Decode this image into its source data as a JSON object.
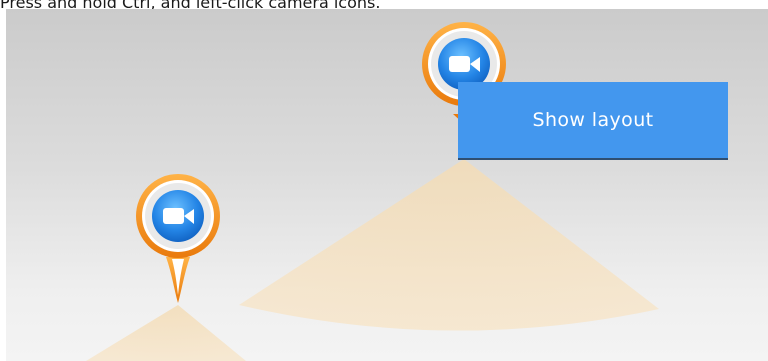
{
  "instruction": {
    "text": "Press and hold Ctrl, and left-click camera icons."
  },
  "context_menu": {
    "items": [
      {
        "label": "Show layout"
      }
    ]
  },
  "map": {
    "cameras": [
      {
        "icon": "video-camera-icon"
      },
      {
        "icon": "video-camera-icon"
      }
    ]
  },
  "colors": {
    "menu_background": "#4397ee",
    "marker_ring": "#f08a1c",
    "camera_badge": "#1f7fe0",
    "view_cone": "#f6e1be"
  }
}
